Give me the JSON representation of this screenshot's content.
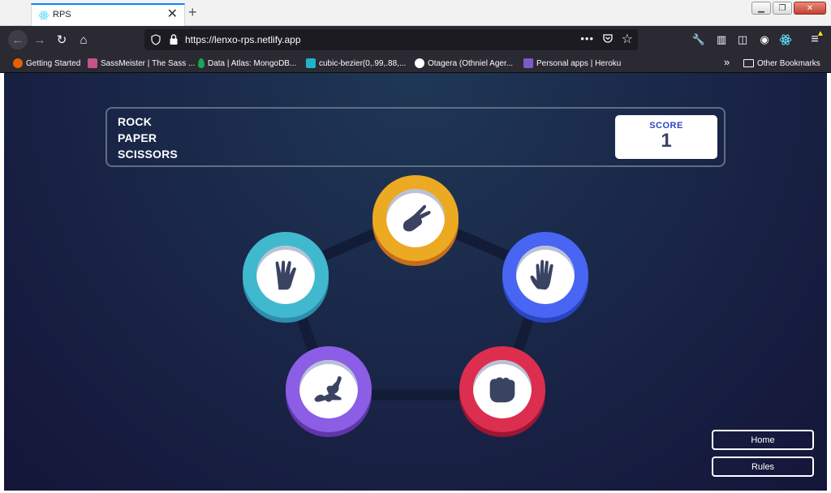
{
  "browser": {
    "tab_title": "RPS",
    "new_tab": "+",
    "url": "https://lenxo-rps.netlify.app",
    "bookmarks": [
      {
        "label": "Getting Started",
        "color": "#e66000"
      },
      {
        "label": "SassMeister | The Sass ...",
        "color": "#c6538c"
      },
      {
        "label": "Data | Atlas: MongoDB...",
        "color": "#13aa52"
      },
      {
        "label": "cubic-bezier(0,.99,.88,...",
        "color": "#1fb5c7"
      },
      {
        "label": "Otagera (Othniel Ager...",
        "color": "#ffffff"
      },
      {
        "label": "Personal apps | Heroku",
        "color": "#7b5cc6"
      }
    ],
    "other_bookmarks": "Other Bookmarks"
  },
  "game": {
    "title_lines": [
      "ROCK",
      "PAPER",
      "SCISSORS"
    ],
    "score_label": "SCORE",
    "score_value": "1",
    "tokens": [
      {
        "name": "scissors",
        "color": "#eca922",
        "shadow": "#c76c1b"
      },
      {
        "name": "paper",
        "color": "#4865f4",
        "shadow": "#2a45c2"
      },
      {
        "name": "rock",
        "color": "#dc2e4e",
        "shadow": "#9d1634"
      },
      {
        "name": "lizard",
        "color": "#8c5de5",
        "shadow": "#5f37a8"
      },
      {
        "name": "spock",
        "color": "#40b9ce",
        "shadow": "#2d8dab"
      }
    ]
  },
  "buttons": {
    "home": "Home",
    "rules": "Rules"
  }
}
